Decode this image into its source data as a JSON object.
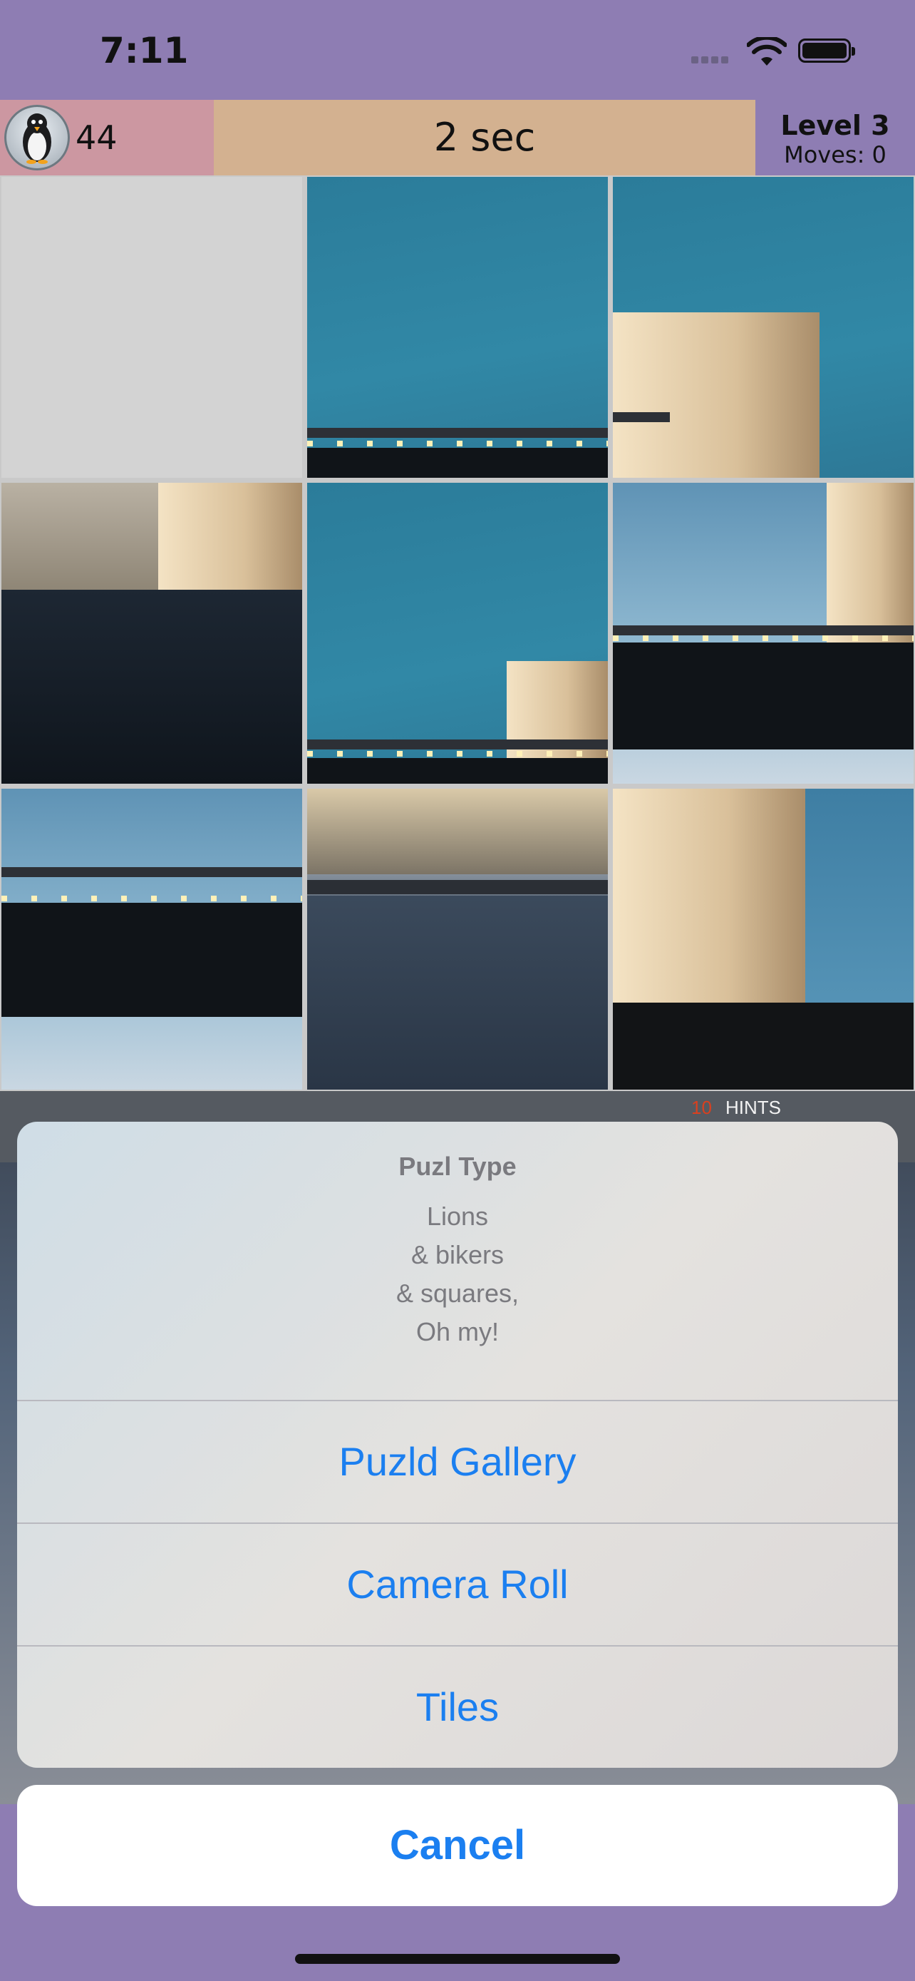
{
  "status_bar": {
    "time": "7:11",
    "icons": [
      "cellular-icon",
      "wifi-icon",
      "battery-icon"
    ]
  },
  "header": {
    "score": "44",
    "timer": "2 sec",
    "level": "Level 3",
    "moves": "Moves: 0",
    "colors": {
      "score_bg": "#cc97a1",
      "timer_bg": "#d3b190",
      "level_bg": "#8e7db3"
    }
  },
  "puzzle": {
    "grid_size": 3,
    "empty_tile": 0
  },
  "lower_bar": {
    "hint_count": "10",
    "hint_label": "HINTS"
  },
  "action_sheet": {
    "title": "Puzl Type",
    "message_lines": [
      "Lions",
      "& bikers",
      "& squares,",
      "Oh my!"
    ],
    "actions": [
      "Puzld Gallery",
      "Camera Roll",
      "Tiles"
    ],
    "cancel": "Cancel",
    "accent": "#1b7ff0"
  }
}
